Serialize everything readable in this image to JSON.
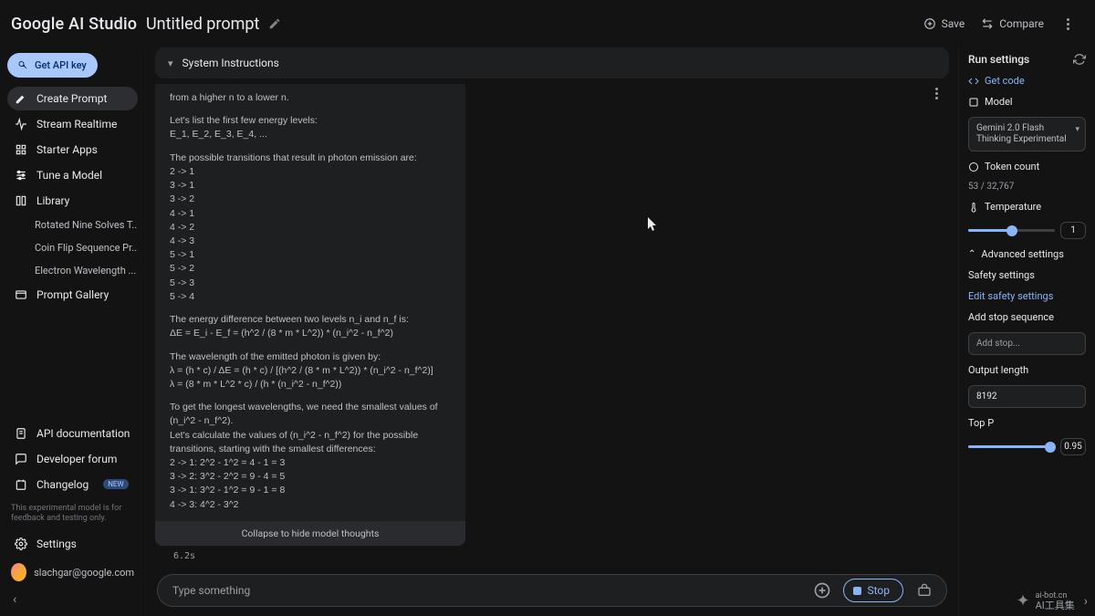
{
  "header": {
    "logo": "Google AI Studio",
    "title": "Untitled prompt",
    "save": "Save",
    "compare": "Compare"
  },
  "sidebar": {
    "api_key": "Get API key",
    "items": [
      "Create Prompt",
      "Stream Realtime",
      "Starter Apps",
      "Tune a Model",
      "Library"
    ],
    "library": [
      "Rotated Nine Solves T...",
      "Coin Flip Sequence Pr...",
      "Electron Wavelength ..."
    ],
    "prompt_gallery": "Prompt Gallery",
    "bottom": [
      "API documentation",
      "Developer forum",
      "Changelog"
    ],
    "changelog_badge": "NEW",
    "disclaimer": "This experimental model is for feedback and testing only.",
    "settings": "Settings",
    "user": "slachgar@google.com"
  },
  "sys_instructions_label": "System Instructions",
  "thoughts": {
    "lines": [
      "from a higher n to a lower n.",
      "",
      "Let's list the first few energy levels:",
      "E_1, E_2, E_3, E_4, ...",
      "",
      "The possible transitions that result in photon emission are:",
      "2 -> 1",
      "3 -> 1",
      "3 -> 2",
      "4 -> 1",
      "4 -> 2",
      "4 -> 3",
      "5 -> 1",
      "5 -> 2",
      "5 -> 3",
      "5 -> 4",
      "",
      "The energy difference between two levels n_i and n_f is:",
      "ΔE = E_i - E_f = (h^2 / (8 * m * L^2)) * (n_i^2 - n_f^2)",
      "",
      "The wavelength of the emitted photon is given by:",
      "λ = (h * c) / ΔE = (h * c) / [(h^2 / (8 * m * L^2)) * (n_i^2 - n_f^2)]",
      "λ = (8 * m * L^2 * c) / (h * (n_i^2 - n_f^2))",
      "",
      "To get the longest wavelengths, we need the smallest values of (n_i^2 - n_f^2).",
      "Let's calculate the values of (n_i^2 - n_f^2) for the possible transitions, starting with the smallest differences:",
      "2 -> 1: 2^2 - 1^2 = 4 - 1 = 3",
      "3 -> 2: 3^2 - 2^2 = 9 - 4 = 5",
      "3 -> 1: 3^2 - 1^2 = 9 - 1 = 8",
      "4 -> 3: 4^2 - 3^2"
    ],
    "collapse": "Collapse to hide model thoughts",
    "elapsed": "6.2s"
  },
  "input": {
    "placeholder": "Type something",
    "stop": "Stop"
  },
  "run": {
    "title": "Run settings",
    "get_code": "Get code",
    "model_label": "Model",
    "model": "Gemini 2.0 Flash Thinking Experimental",
    "token_label": "Token count",
    "token_value": "53 / 32,767",
    "temp_label": "Temperature",
    "temp_value": "1",
    "adv": "Advanced settings",
    "safety": "Safety settings",
    "edit_safety": "Edit safety settings",
    "stop_seq_label": "Add stop sequence",
    "stop_seq_ph": "Add stop...",
    "out_len_label": "Output length",
    "out_len_value": "8192",
    "top_p_label": "Top P",
    "top_p_value": "0.95"
  },
  "watermark": {
    "line1": "ai-bot.cn",
    "line2": "AI工具集"
  }
}
